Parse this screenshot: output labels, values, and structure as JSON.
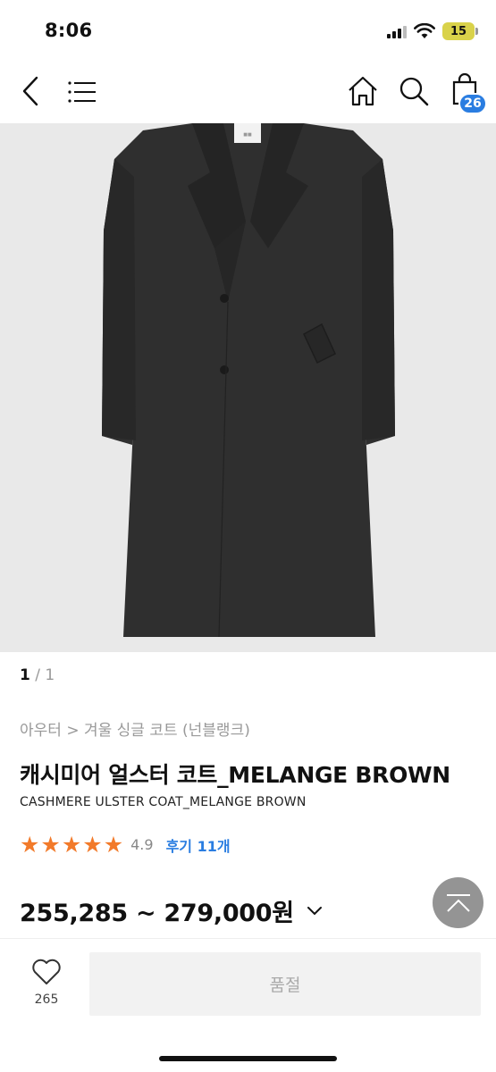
{
  "status_bar": {
    "time": "8:06",
    "battery": "15"
  },
  "header": {
    "cart_count": "26"
  },
  "icons": {
    "back": "chevron-left-icon",
    "menu": "hamburger-menu-icon",
    "home": "home-icon",
    "search": "search-icon",
    "cart": "shopping-bag-icon",
    "heart": "heart-icon",
    "scroll_top": "arrow-up-icon",
    "expand": "chevron-down-icon"
  },
  "pager": {
    "current": "1",
    "separator": " / ",
    "total": "1"
  },
  "product": {
    "breadcrumb": "아우터 > 겨울 싱글 코트 (넌블랭크)",
    "title_ko": "캐시미어 얼스터 코트_MELANGE BROWN",
    "title_en": "CASHMERE ULSTER COAT_MELANGE BROWN",
    "rating": 4.9,
    "rating_text": "4.9",
    "stars_filled": 5,
    "review_label": "후기 11개",
    "price": "255,285 ~ 279,000원"
  },
  "bottom_bar": {
    "like_count": "265",
    "soldout_label": "품절"
  },
  "colors": {
    "accent": "#2a7de1",
    "star": "#f27a2a",
    "coat": "#2f2f2f",
    "image_bg": "#e9e9e9"
  }
}
